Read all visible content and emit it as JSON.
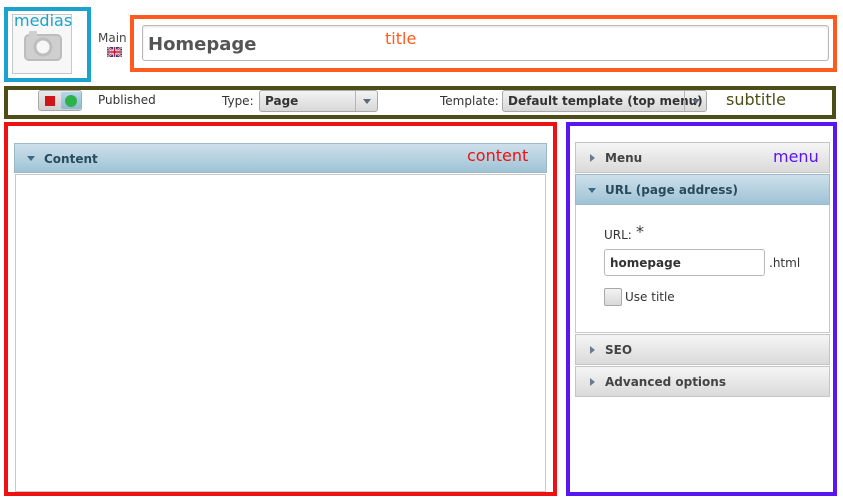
{
  "annotations": {
    "medias": "medias",
    "title": "title",
    "subtitle": "subtitle",
    "content": "content",
    "menu": "menu"
  },
  "colors": {
    "medias": "#1aa3cc",
    "title": "#ff5a1f",
    "subtitle": "#4d4d17",
    "content": "#ee1111",
    "menu": "#5a16f0",
    "panel_header": "#9fc3d6"
  },
  "language": {
    "label": "Main",
    "flag_icon": "uk-flag-icon"
  },
  "media": {
    "icon": "camera-icon"
  },
  "title_field": {
    "value": "Homepage"
  },
  "status": {
    "label": "Published",
    "toggle_state": "online"
  },
  "type_select": {
    "label": "Type:",
    "value": "Page"
  },
  "template_select": {
    "label": "Template:",
    "value": "Default template (top menu)"
  },
  "content_panel": {
    "header": "Content"
  },
  "sidebar": {
    "menu_label": "Menu",
    "url_section": {
      "header": "URL (page address)",
      "url_label": "URL:",
      "required_mark": "*",
      "url_value": "homepage",
      "extension": ".html",
      "use_title_label": "Use title",
      "use_title_checked": false
    },
    "seo_label": "SEO",
    "advanced_label": "Advanced options"
  }
}
